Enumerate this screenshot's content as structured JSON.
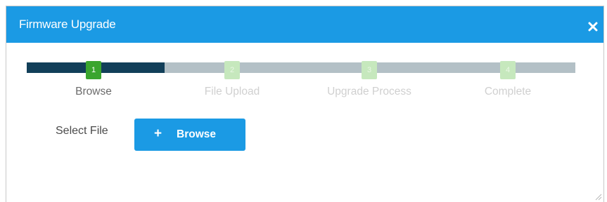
{
  "dialog": {
    "title": "Firmware Upgrade",
    "close_icon": "close-icon",
    "accent_color": "#1b9ae4"
  },
  "steps": [
    {
      "number": "1",
      "label": "Browse",
      "state": "active"
    },
    {
      "number": "2",
      "label": "File Upload",
      "state": "inactive"
    },
    {
      "number": "3",
      "label": "Upgrade Process",
      "state": "inactive"
    },
    {
      "number": "4",
      "label": "Complete",
      "state": "inactive"
    }
  ],
  "progress": {
    "completed_color": "#123f59",
    "pending_color": "#b3c0c6",
    "active_step_color": "#3aa52e"
  },
  "form": {
    "select_file_label": "Select File",
    "browse_button_label": "Browse",
    "browse_button_icon": "plus-icon"
  }
}
